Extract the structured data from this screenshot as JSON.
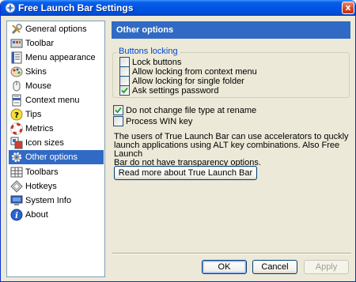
{
  "window": {
    "title": "Free Launch Bar Settings",
    "close_glyph": "x"
  },
  "sidebar": {
    "items": [
      {
        "label": "General options",
        "icon": "tools-icon"
      },
      {
        "label": "Toolbar",
        "icon": "toolbar-icon"
      },
      {
        "label": "Menu appearance",
        "icon": "menu-icon"
      },
      {
        "label": "Skins",
        "icon": "palette-icon"
      },
      {
        "label": "Mouse",
        "icon": "mouse-icon"
      },
      {
        "label": "Context menu",
        "icon": "context-menu-icon"
      },
      {
        "label": "Tips",
        "icon": "tip-icon",
        "icon_text": "?"
      },
      {
        "label": "Metrics",
        "icon": "lifebuoy-icon"
      },
      {
        "label": "Icon sizes",
        "icon": "icon-sizes-icon"
      },
      {
        "label": "Other options",
        "icon": "gear-icon",
        "selected": true
      },
      {
        "label": "Toolbars",
        "icon": "toolbars-icon"
      },
      {
        "label": "Hotkeys",
        "icon": "hotkey-icon"
      },
      {
        "label": "System Info",
        "icon": "computer-icon"
      },
      {
        "label": "About",
        "icon": "info-icon",
        "icon_text": "i"
      }
    ]
  },
  "main": {
    "header": "Other options",
    "buttons_locking": {
      "label": "Buttons locking",
      "options": [
        {
          "label": "Lock buttons",
          "checked": false
        },
        {
          "label": "Allow locking from context menu",
          "checked": false
        },
        {
          "label": "Allow locking for single folder",
          "checked": false
        },
        {
          "label": "Ask settings password",
          "checked": true
        }
      ]
    },
    "options": [
      {
        "label": "Do not change file type at rename",
        "checked": true
      },
      {
        "label": "Process WIN key",
        "checked": false
      }
    ],
    "description_lines": [
      "The users of True Launch Bar can use accelerators to quckly",
      "launch applications using ALT key combinations. Also Free Launch",
      "Bar do not have transparency options."
    ],
    "read_more_label": "Read more about True Launch Bar"
  },
  "footer": {
    "ok_label": "OK",
    "cancel_label": "Cancel",
    "apply_label": "Apply"
  },
  "colors": {
    "selection": "#316ac5",
    "titlebar": "#0054e3",
    "group_label": "#0046d5",
    "dialog_bg": "#ece9d8"
  }
}
